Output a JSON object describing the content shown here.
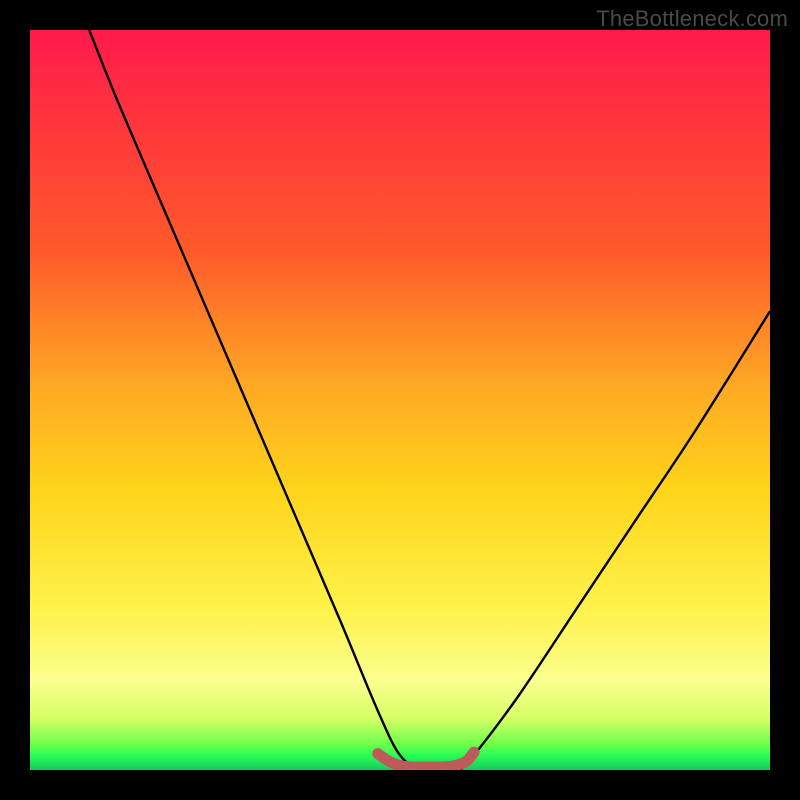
{
  "watermark": "TheBottleneck.com",
  "chart_data": {
    "type": "line",
    "title": "",
    "xlabel": "",
    "ylabel": "",
    "xlim": [
      0,
      100
    ],
    "ylim": [
      0,
      100
    ],
    "series": [
      {
        "name": "bottleneck-curve",
        "x": [
          8,
          12,
          18,
          24,
          30,
          36,
          42,
          47,
          50,
          53,
          56,
          58,
          60,
          66,
          74,
          82,
          90,
          100
        ],
        "y": [
          100,
          90,
          76,
          62,
          48,
          34,
          20,
          8,
          2,
          0,
          0,
          0,
          2,
          10,
          22,
          34,
          46,
          62
        ]
      },
      {
        "name": "valley-highlight",
        "x": [
          47,
          48.5,
          50,
          51.5,
          53,
          54.5,
          56,
          57.5,
          59,
          60
        ],
        "y": [
          2.2,
          1.2,
          0.6,
          0.4,
          0.4,
          0.4,
          0.4,
          0.6,
          1.2,
          2.4
        ]
      }
    ],
    "colors": {
      "curve": "#000000",
      "valley_highlight": "#bf5a5a",
      "gradient_top": "#ff1a4d",
      "gradient_mid": "#ffd41a",
      "gradient_bottom": "#18c95e",
      "frame": "#000000"
    }
  }
}
